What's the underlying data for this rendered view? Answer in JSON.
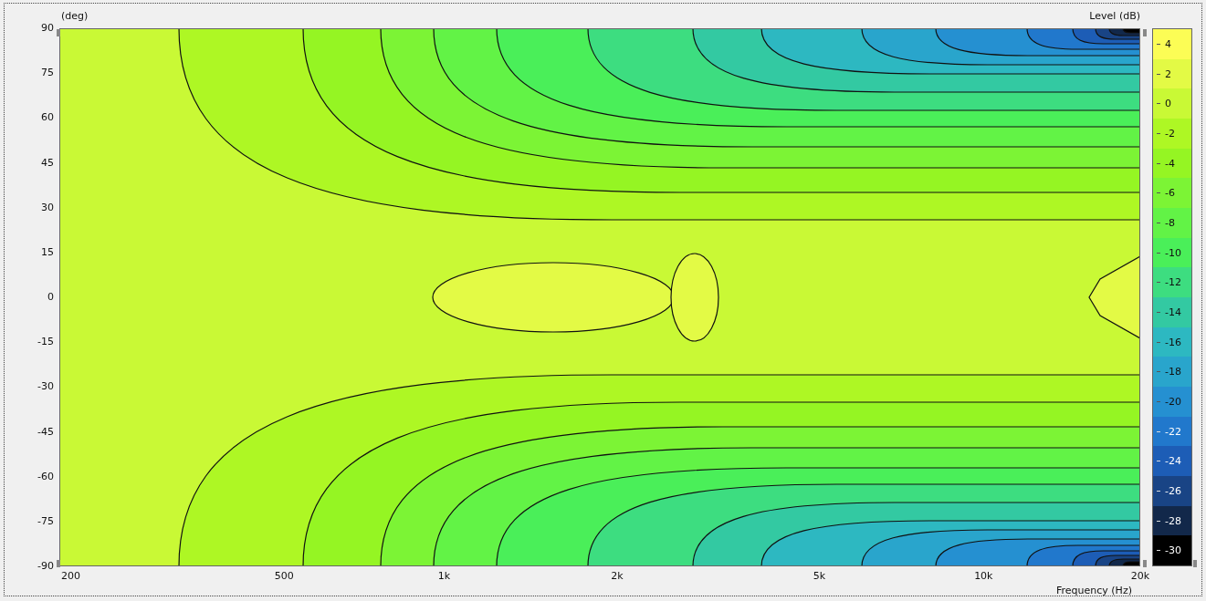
{
  "y_axis": {
    "title": "(deg)",
    "ticks": [
      "90",
      "75",
      "60",
      "45",
      "30",
      "15",
      "0",
      "-15",
      "-30",
      "-45",
      "-60",
      "-75",
      "-90"
    ]
  },
  "x_axis": {
    "title": "Frequency  (Hz)",
    "ticks": [
      "200",
      "500",
      "1k",
      "2k",
      "5k",
      "10k",
      "20k"
    ]
  },
  "color_scale": {
    "title": "Level  (dB)",
    "levels": [
      {
        "label": "4",
        "color": "#fcfd55"
      },
      {
        "label": "2",
        "color": "#e3fa45"
      },
      {
        "label": "0",
        "color": "#c9f935"
      },
      {
        "label": "-2",
        "color": "#aef724"
      },
      {
        "label": "-4",
        "color": "#95f523"
      },
      {
        "label": "-6",
        "color": "#7cf435"
      },
      {
        "label": "-8",
        "color": "#62f346"
      },
      {
        "label": "-10",
        "color": "#4aef59"
      },
      {
        "label": "-12",
        "color": "#3ddd80"
      },
      {
        "label": "-14",
        "color": "#33c9a2"
      },
      {
        "label": "-16",
        "color": "#2db8c1"
      },
      {
        "label": "-18",
        "color": "#29a5cc"
      },
      {
        "label": "-20",
        "color": "#2590d1"
      },
      {
        "label": "-22",
        "color": "#2178cc"
      },
      {
        "label": "-24",
        "color": "#1d5db6"
      },
      {
        "label": "-26",
        "color": "#194485"
      },
      {
        "label": "-28",
        "color": "#12284a"
      },
      {
        "label": "-30",
        "color": "#000000"
      }
    ]
  }
}
